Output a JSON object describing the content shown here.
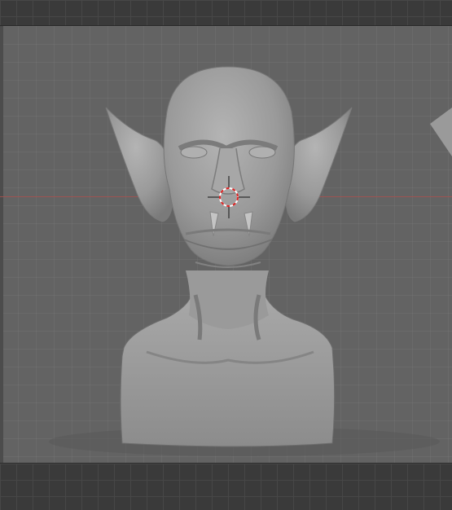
{
  "viewport": {
    "mode": "3d-viewport",
    "object": "sculpt-bust",
    "shading": "solid",
    "grid": true,
    "x_axis_color": "#a4524f",
    "background_color": "#636363",
    "cursor_icon": "3d-cursor-icon"
  },
  "colors": {
    "header_bg": "#3a3a3a",
    "model": "#9f9f9f"
  }
}
